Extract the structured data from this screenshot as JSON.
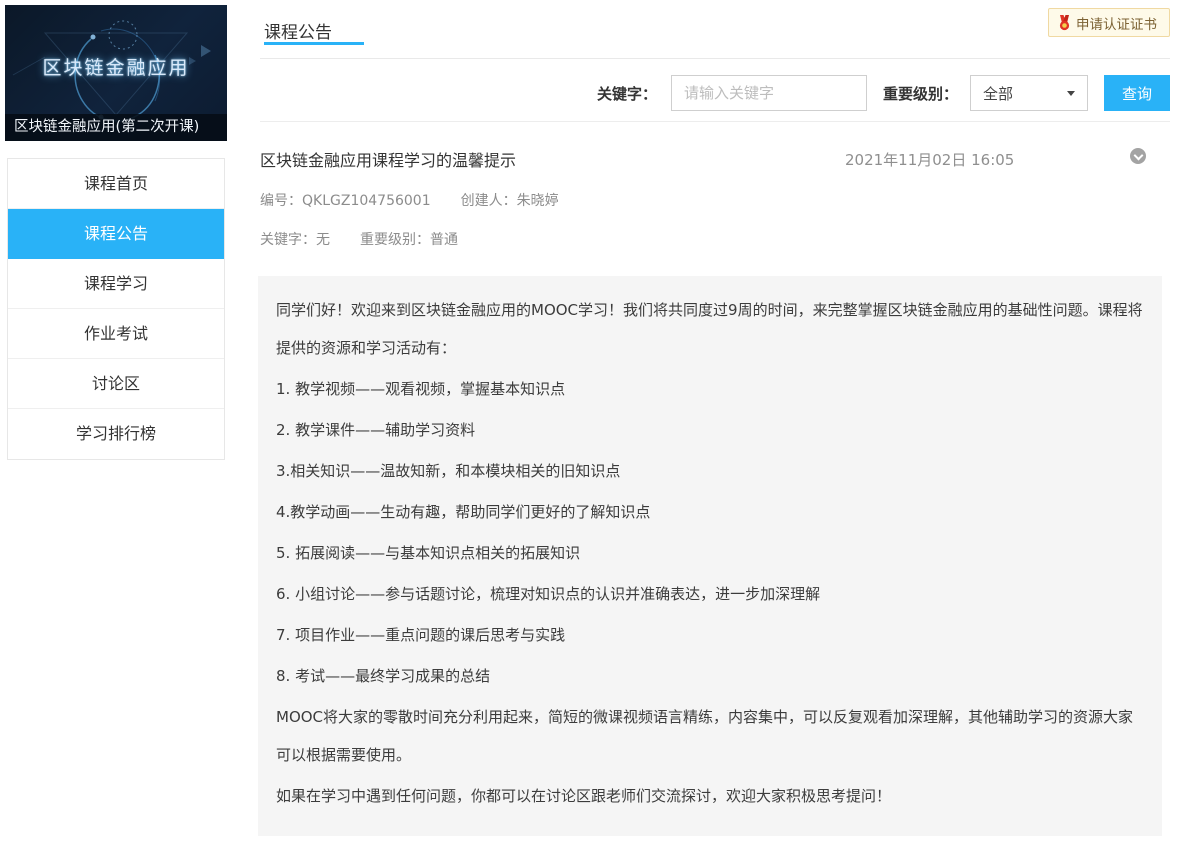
{
  "colors": {
    "accent": "#29b2f7",
    "cert_border": "#f0d9a2",
    "cert_bg": "#fefae9",
    "panel_bg": "#f5f5f5"
  },
  "course": {
    "banner_title": "区块链金融应用",
    "banner_caption": "区块链金融应用(第二次开课)"
  },
  "sidebar": {
    "items": [
      {
        "label": "课程首页",
        "active": false
      },
      {
        "label": "课程公告",
        "active": true
      },
      {
        "label": "课程学习",
        "active": false
      },
      {
        "label": "作业考试",
        "active": false
      },
      {
        "label": "讨论区",
        "active": false
      },
      {
        "label": "学习排行榜",
        "active": false
      }
    ]
  },
  "header": {
    "tab_label": "课程公告",
    "certificate_button": "申请认证证书"
  },
  "search": {
    "keyword_label": "关键字：",
    "keyword_placeholder": "请输入关键字",
    "level_label": "重要级别：",
    "level_value": "全部",
    "query_button": "查询"
  },
  "announcement": {
    "title": "区块链金融应用课程学习的温馨提示",
    "date": "2021年11月02日 16:05",
    "meta": {
      "number_label": "编号：",
      "number": "QKLGZ104756001",
      "creator_label": "创建人：",
      "creator": "朱晓婷",
      "keyword_label": "关键字：",
      "keyword": "无",
      "level_label": "重要级别：",
      "level": "普通"
    },
    "paragraphs": [
      "同学们好！欢迎来到区块链金融应用的MOOC学习！我们将共同度过9周的时间，来完整掌握区块链金融应用的基础性问题。课程将提供的资源和学习活动有：",
      "1. 教学视频——观看视频，掌握基本知识点",
      "2. 教学课件——辅助学习资料",
      "3.相关知识——温故知新，和本模块相关的旧知识点",
      "4.教学动画——生动有趣，帮助同学们更好的了解知识点",
      "5. 拓展阅读——与基本知识点相关的拓展知识",
      "6. 小组讨论——参与话题讨论，梳理对知识点的认识并准确表达，进一步加深理解",
      "7. 项目作业——重点问题的课后思考与实践",
      "8. 考试——最终学习成果的总结",
      "MOOC将大家的零散时间充分利用起来，简短的微课视频语言精练，内容集中，可以反复观看加深理解，其他辅助学习的资源大家可以根据需要使用。",
      "如果在学习中遇到任何问题，你都可以在讨论区跟老师们交流探讨，欢迎大家积极思考提问！"
    ]
  }
}
